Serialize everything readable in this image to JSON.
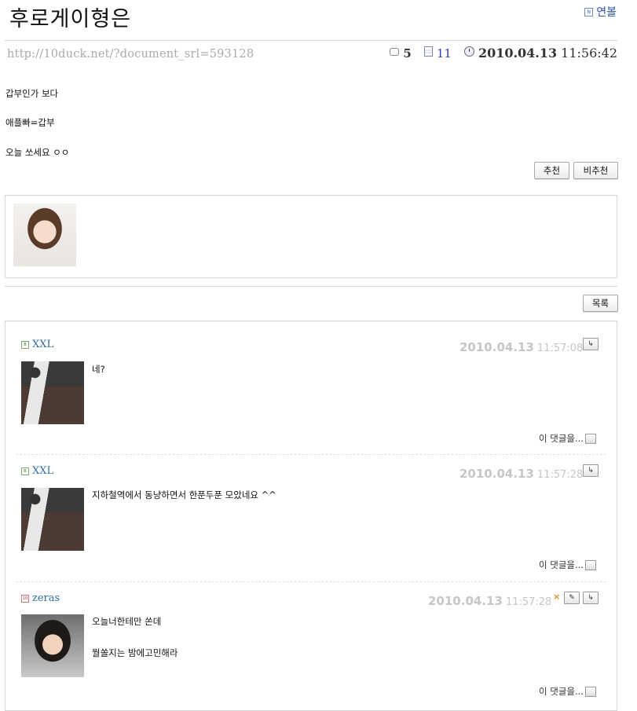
{
  "post": {
    "title": "후로게이형은",
    "author_link": "연볼",
    "url": "http://10duck.net/?document_srl=593128",
    "comment_count": "5",
    "read_count": "11",
    "date": "2010.04.13",
    "time": "11:56:42",
    "lines": [
      "갑부인가 보다",
      "애플빠=갑부",
      "오늘 쏘세요 ㅇㅇ"
    ]
  },
  "buttons": {
    "recommend": "추천",
    "not_recommend": "비추천",
    "list": "목록"
  },
  "comments": [
    {
      "author": "XXL",
      "date": "2010.04.13",
      "time": "11:57:08",
      "lines": [
        "네?"
      ],
      "reply_label": "이 댓글을..."
    },
    {
      "author": "XXL",
      "date": "2010.04.13",
      "time": "11:57:28",
      "lines": [
        "지하철역에서 동냥하면서 한푼두푼 모았네요 ^^"
      ],
      "reply_label": "이 댓글을..."
    },
    {
      "author": "zeras",
      "date": "2010.04.13",
      "time": "11:57:28",
      "lines": [
        "오늘너한테만 쏜데",
        "뭘쏠지는 밤에고민해라"
      ],
      "reply_label": "이 댓글을..."
    }
  ],
  "icons": {
    "author_badge": "profile-icon",
    "comment_count": "speech-bubble-icon",
    "read_count": "document-icon",
    "date": "clock-icon",
    "reply_action": "reply-arrow-icon",
    "edit_action": "eraser-icon",
    "delete_action": "x-icon"
  },
  "colors": {
    "link": "#2a56a8",
    "comment_author": "#2d6e9a",
    "comment_date": "#c6c6c6",
    "read_count": "#2f3fa8"
  }
}
